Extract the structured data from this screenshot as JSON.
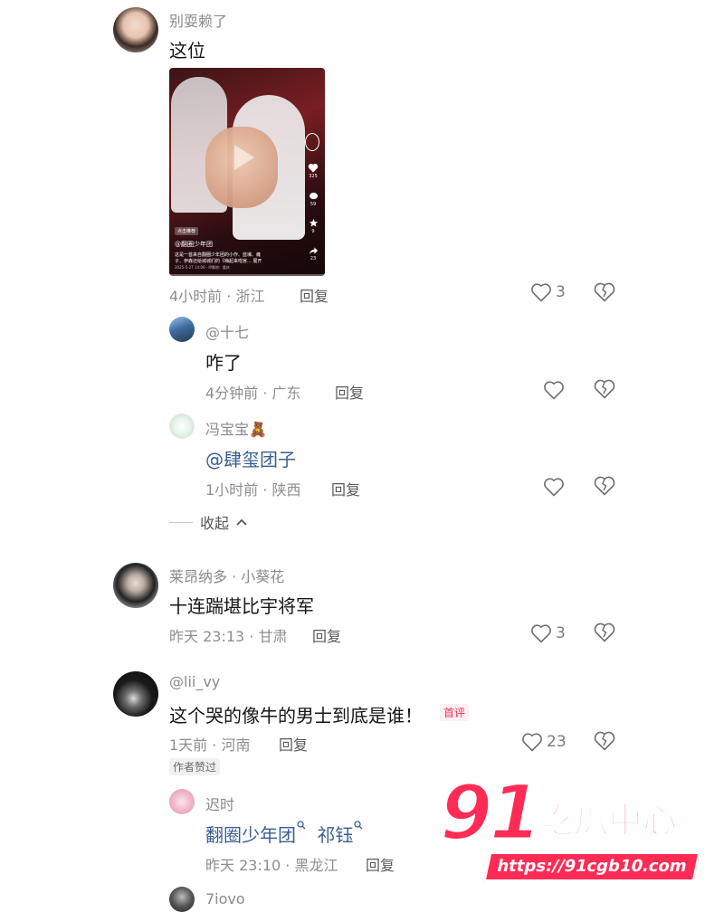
{
  "comments": [
    {
      "username": "别耍赖了",
      "text": "这位",
      "time": "4小时前",
      "location": "浙江",
      "reply_label": "回复",
      "likes": "3",
      "video_card": {
        "caption_handle": "@翻圈少年团",
        "caption_line1": "这是一首来自翻圈少年团的小作、蓝壕、瘫",
        "caption_line2": "子、伊森还给城城们的《嗨起来啦宫... 展开",
        "date_line": "2025-5-27 14:00 · IP属地：重庆",
        "pill": "点击推荐",
        "side_counts": [
          "325",
          "59",
          "9",
          "23"
        ]
      },
      "replies": [
        {
          "username": "@十七",
          "text": "咋了",
          "time": "4分钟前",
          "location": "广东",
          "reply_label": "回复"
        },
        {
          "username": "冯宝宝",
          "username_emoji": "🧸",
          "text": "@肆玺团子",
          "time": "1小时前",
          "location": "陕西",
          "reply_label": "回复"
        }
      ],
      "collapse_label": "收起"
    },
    {
      "username": "莱昂纳多 · 小葵花",
      "text": "十连踹堪比宇将军",
      "time": "昨天 23:13",
      "location": "甘肃",
      "reply_label": "回复",
      "likes": "3"
    },
    {
      "username": "@lii_vy",
      "text": "这个哭的像牛的男士到底是谁！",
      "badge": "首评",
      "time": "1天前",
      "location": "河南",
      "reply_label": "回复",
      "likes": "23",
      "author_badge": "作者赞过",
      "replies": [
        {
          "username": "迟时",
          "text_parts": [
            "翻圈少年团",
            "祁钰"
          ],
          "time": "昨天 23:10",
          "location": "黑龙江",
          "reply_label": "回复"
        }
      ]
    },
    {
      "username": "7iovo"
    }
  ],
  "watermark": {
    "brand_number": "91",
    "brand_text": "吃瓜中心",
    "url": "https://91cgb10.com"
  },
  "colors": {
    "accent": "#fe2c55",
    "mention": "#3a5f93",
    "meta": "#8e8e8e"
  },
  "icons": [
    "heart-outline-icon",
    "broken-heart-icon",
    "search-icon",
    "chevron-up-icon"
  ]
}
